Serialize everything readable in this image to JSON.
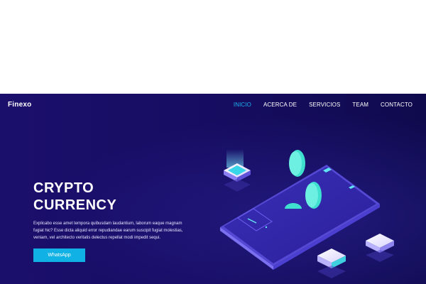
{
  "brand": {
    "name": "Finexo"
  },
  "nav": {
    "items": [
      {
        "label": "INICIO",
        "active": true
      },
      {
        "label": "ACERCA DE",
        "active": false
      },
      {
        "label": "SERVICIOS",
        "active": false
      },
      {
        "label": "TEAM",
        "active": false
      },
      {
        "label": "CONTACTO",
        "active": false
      }
    ]
  },
  "hero": {
    "headline_line1": "CRYPTO",
    "headline_line2": "CURRENCY",
    "description_lines": [
      "Explicabo esse amet tempora quibusdam laudantium, laborum eaque magnam",
      "fugiat hic? Esse dicta aliquid error repudiandae earum suscipit fugiat molestias,",
      "veniam, vel architecto veritatis delectus repellat modi impedit sequi."
    ],
    "cta_label": "WhatsApp"
  },
  "colors": {
    "background": "#170d63",
    "accent": "#1bb3f0",
    "button": "#10b2e6",
    "coin": "#3fe0d0"
  },
  "icons": [
    "phone-illustration",
    "coin-icon",
    "cube-icon"
  ]
}
